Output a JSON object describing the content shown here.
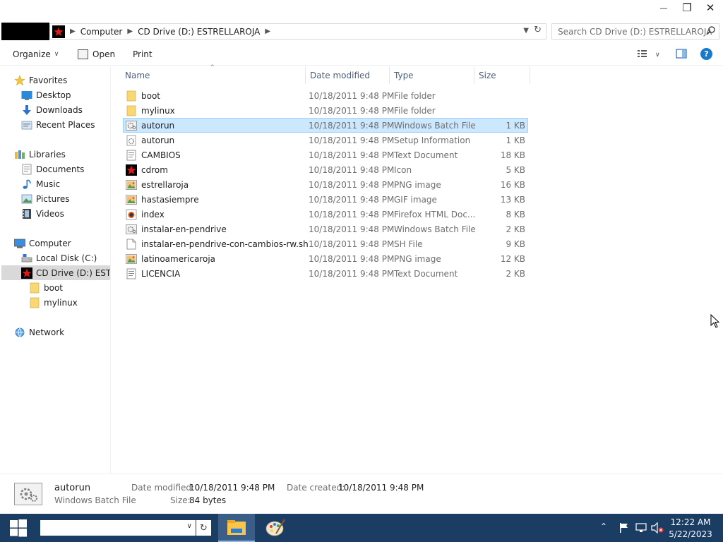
{
  "window": {
    "minimize_glyph": "—",
    "maximize_glyph": "❐",
    "close_glyph": "✕"
  },
  "address": {
    "crumbs": [
      "Computer",
      "CD Drive (D:) ESTRELLAROJA"
    ],
    "search_placeholder": "Search CD Drive (D:) ESTRELLAROJA"
  },
  "toolbar": {
    "organize": "Organize",
    "open": "Open",
    "print": "Print"
  },
  "nav": {
    "favorites": "Favorites",
    "desktop": "Desktop",
    "downloads": "Downloads",
    "recent": "Recent Places",
    "libraries": "Libraries",
    "documents": "Documents",
    "music": "Music",
    "pictures": "Pictures",
    "videos": "Videos",
    "computer": "Computer",
    "local_disk": "Local Disk (C:)",
    "cd_drive": "CD Drive (D:) ESTRELLAROJA",
    "boot": "boot",
    "mylinux": "mylinux",
    "network": "Network"
  },
  "columns": {
    "name": "Name",
    "date": "Date modified",
    "type": "Type",
    "size": "Size"
  },
  "files": [
    {
      "name": "boot",
      "date": "10/18/2011 9:48 PM",
      "type": "File folder",
      "size": "",
      "icon": "folder-icon"
    },
    {
      "name": "mylinux",
      "date": "10/18/2011 9:48 PM",
      "type": "File folder",
      "size": "",
      "icon": "folder-icon"
    },
    {
      "name": "autorun",
      "date": "10/18/2011 9:48 PM",
      "type": "Windows Batch File",
      "size": "1 KB",
      "icon": "batch-file-icon"
    },
    {
      "name": "autorun",
      "date": "10/18/2011 9:48 PM",
      "type": "Setup Information",
      "size": "1 KB",
      "icon": "setup-info-icon"
    },
    {
      "name": "CAMBIOS",
      "date": "10/18/2011 9:48 PM",
      "type": "Text Document",
      "size": "18 KB",
      "icon": "text-document-icon"
    },
    {
      "name": "cdrom",
      "date": "10/18/2011 9:48 PM",
      "type": "Icon",
      "size": "5 KB",
      "icon": "red-star-icon"
    },
    {
      "name": "estrellaroja",
      "date": "10/18/2011 9:48 PM",
      "type": "PNG image",
      "size": "16 KB",
      "icon": "image-icon"
    },
    {
      "name": "hastasiempre",
      "date": "10/18/2011 9:48 PM",
      "type": "GIF image",
      "size": "13 KB",
      "icon": "image-icon"
    },
    {
      "name": "index",
      "date": "10/18/2011 9:48 PM",
      "type": "Firefox HTML Doc...",
      "size": "8 KB",
      "icon": "firefox-html-icon"
    },
    {
      "name": "instalar-en-pendrive",
      "date": "10/18/2011 9:48 PM",
      "type": "Windows Batch File",
      "size": "2 KB",
      "icon": "batch-file-icon"
    },
    {
      "name": "instalar-en-pendrive-con-cambios-rw.sh",
      "date": "10/18/2011 9:48 PM",
      "type": "SH File",
      "size": "9 KB",
      "icon": "blank-file-icon"
    },
    {
      "name": "latinoamericaroja",
      "date": "10/18/2011 9:48 PM",
      "type": "PNG image",
      "size": "12 KB",
      "icon": "image-icon"
    },
    {
      "name": "LICENCIA",
      "date": "10/18/2011 9:48 PM",
      "type": "Text Document",
      "size": "2 KB",
      "icon": "text-document-icon"
    }
  ],
  "details": {
    "name": "autorun",
    "type": "Windows Batch File",
    "modified_label": "Date modified:",
    "modified_value": "10/18/2011 9:48 PM",
    "created_label": "Date created:",
    "created_value": "10/18/2011 9:48 PM",
    "size_label": "Size:",
    "size_value": "84 bytes"
  },
  "taskbar": {
    "time": "12:22 AM",
    "date": "5/22/2023"
  },
  "colors": {
    "selection": "#cce8ff",
    "taskbar": "#1b3c63",
    "folder": "#f8d775",
    "accent": "#1979ca"
  }
}
